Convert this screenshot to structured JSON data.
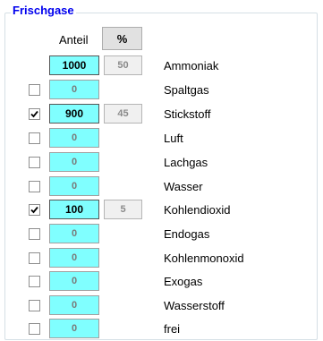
{
  "group": {
    "title": "Frischgase"
  },
  "header": {
    "anteil_label": "Anteil",
    "percent_button": "%"
  },
  "gases": [
    {
      "name": "Ammoniak",
      "value": "1000",
      "percent": "50",
      "checked": false,
      "checkbox_visible": false
    },
    {
      "name": "Spaltgas",
      "value": "0",
      "percent": "",
      "checked": false,
      "checkbox_visible": true
    },
    {
      "name": "Stickstoff",
      "value": "900",
      "percent": "45",
      "checked": true,
      "checkbox_visible": true
    },
    {
      "name": "Luft",
      "value": "0",
      "percent": "",
      "checked": false,
      "checkbox_visible": true
    },
    {
      "name": "Lachgas",
      "value": "0",
      "percent": "",
      "checked": false,
      "checkbox_visible": true
    },
    {
      "name": "Wasser",
      "value": "0",
      "percent": "",
      "checked": false,
      "checkbox_visible": true
    },
    {
      "name": "Kohlendioxid",
      "value": "100",
      "percent": "5",
      "checked": true,
      "checkbox_visible": true
    },
    {
      "name": "Endogas",
      "value": "0",
      "percent": "",
      "checked": false,
      "checkbox_visible": true
    },
    {
      "name": "Kohlenmonoxid",
      "value": "0",
      "percent": "",
      "checked": false,
      "checkbox_visible": true
    },
    {
      "name": "Exogas",
      "value": "0",
      "percent": "",
      "checked": false,
      "checkbox_visible": true
    },
    {
      "name": "Wasserstoff",
      "value": "0",
      "percent": "",
      "checked": false,
      "checkbox_visible": true
    },
    {
      "name": "frei",
      "value": "0",
      "percent": "",
      "checked": false,
      "checkbox_visible": true
    }
  ]
}
